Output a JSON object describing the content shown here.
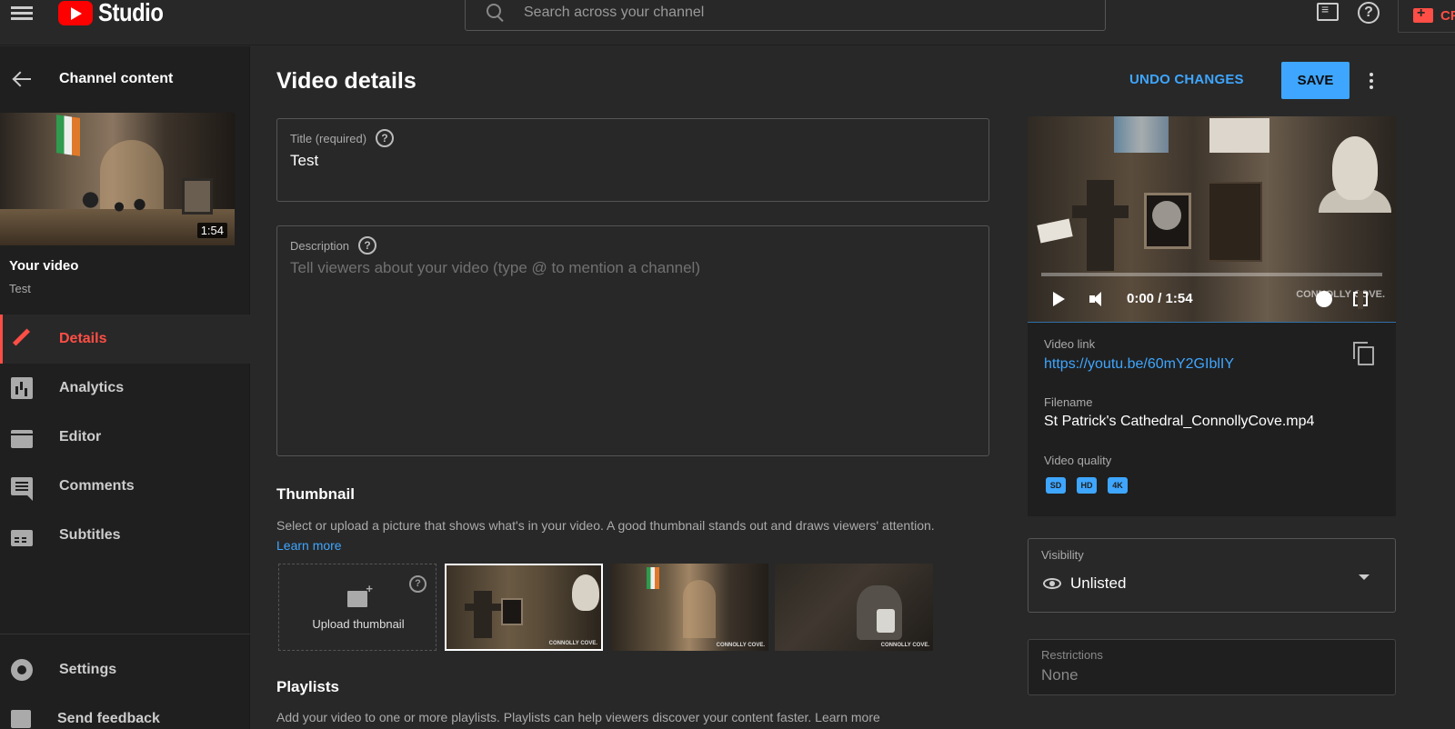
{
  "header": {
    "logo_text": "Studio",
    "search_placeholder": "Search across your channel",
    "create_label": "CR"
  },
  "sidebar": {
    "back_label": "Channel content",
    "thumbnail_duration": "1:54",
    "your_video_label": "Your video",
    "video_title": "Test",
    "items": [
      {
        "label": "Details",
        "icon": "pencil-icon",
        "active": true
      },
      {
        "label": "Analytics",
        "icon": "analytics-icon",
        "active": false
      },
      {
        "label": "Editor",
        "icon": "editor-icon",
        "active": false
      },
      {
        "label": "Comments",
        "icon": "comments-icon",
        "active": false
      },
      {
        "label": "Subtitles",
        "icon": "subtitles-icon",
        "active": false
      }
    ],
    "settings_label": "Settings",
    "feedback_label": "Send feedback"
  },
  "main": {
    "page_title": "Video details",
    "undo_label": "UNDO CHANGES",
    "save_label": "SAVE",
    "title_field": {
      "label": "Title (required)",
      "value": "Test"
    },
    "description_field": {
      "label": "Description",
      "placeholder": "Tell viewers about your video (type @ to mention a channel)"
    },
    "thumbnail": {
      "title": "Thumbnail",
      "description": "Select or upload a picture that shows what's in your video. A good thumbnail stands out and draws viewers' attention.",
      "learn_more": "Learn more",
      "upload_label": "Upload thumbnail",
      "watermark": "CONNOLLY COVE."
    },
    "playlists": {
      "title": "Playlists",
      "description": "Add your video to one or more playlists. Playlists can help viewers discover your content faster. Learn more"
    }
  },
  "right": {
    "player_time": "0:00 / 1:54",
    "player_watermark": "CONNOLLY COVE.",
    "video_link_label": "Video link",
    "video_link": "https://youtu.be/60mY2GIblIY",
    "filename_label": "Filename",
    "filename": "St Patrick's Cathedral_ConnollyCove.mp4",
    "quality_label": "Video quality",
    "quality_badges": [
      "SD",
      "HD",
      "4K"
    ],
    "visibility_label": "Visibility",
    "visibility_value": "Unlisted",
    "restrictions_label": "Restrictions",
    "restrictions_value": "None"
  },
  "colors": {
    "accent_blue": "#3ea6ff",
    "active_red": "#ff4e45",
    "logo_red": "#ff0000",
    "background": "#282828",
    "sidebar_background": "#1f1f1f"
  }
}
